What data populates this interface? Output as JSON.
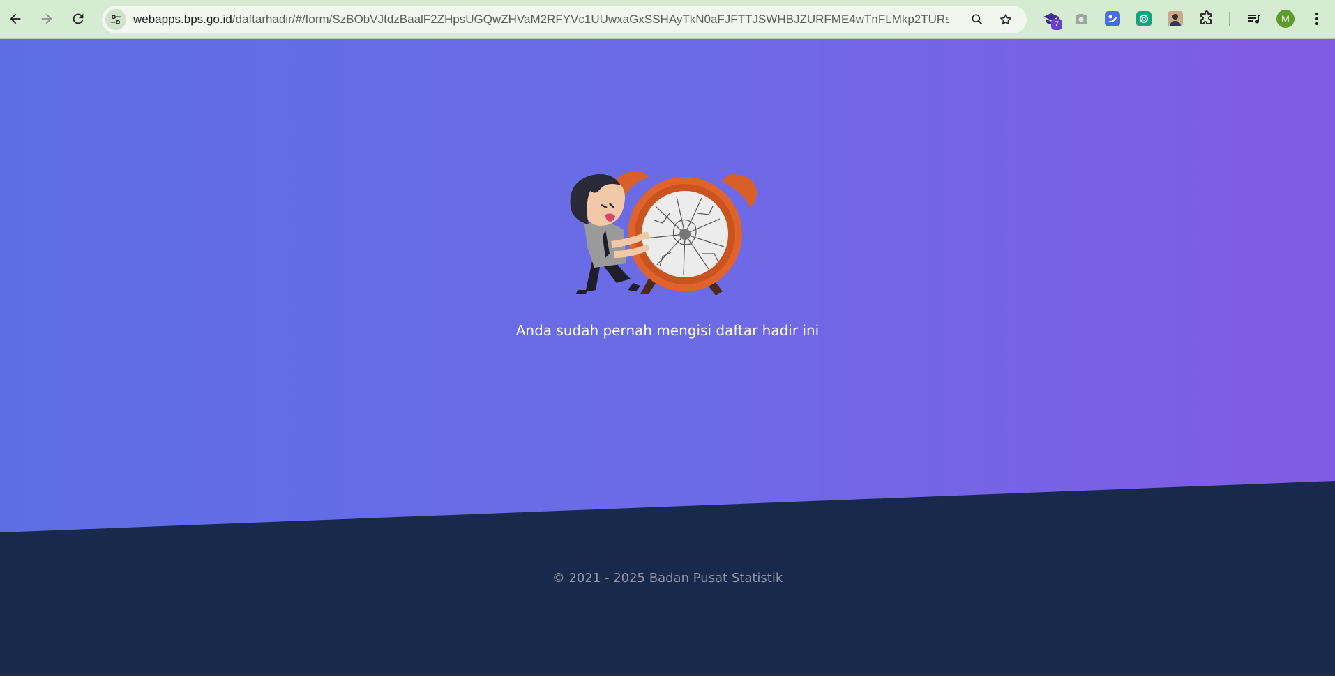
{
  "browser": {
    "url_host": "webapps.bps.go.id",
    "url_path": "/daftarhadir/#/form/SzBObVJtdzBaalF2ZHpsUGQwZHVaM2RFYVc1UUwxaGxSSHAyTkN0aFJFTTJSWHBJZURFME4wTnFLMkp2TURsME1...",
    "extension_badge": "7",
    "profile_initial": "M",
    "colors": {
      "toolbar": "#d6ecd2",
      "omnibox": "#f1f7ef"
    }
  },
  "page": {
    "message": "Anda sudah pernah mengisi daftar hadir ini",
    "copyright": "© 2021 - 2025 Badan Pusat Statistik",
    "illustration": "man-pushing-broken-alarm-clock",
    "colors": {
      "gradient_start": "#5d6ee4",
      "gradient_end": "#815be3",
      "footer": "#182a4b",
      "clock": "#e0632c"
    }
  }
}
